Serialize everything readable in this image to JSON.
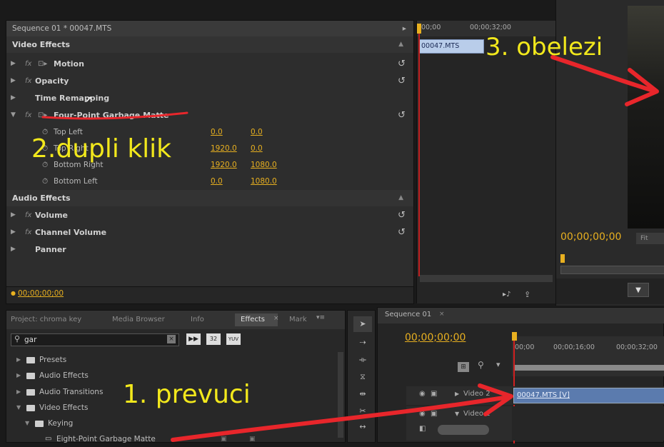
{
  "effect_controls": {
    "title": "Sequence 01 * 00047.MTS",
    "video_effects_label": "Video Effects",
    "effects": [
      {
        "name": "Motion"
      },
      {
        "name": "Opacity"
      },
      {
        "name": "Time Remapping"
      },
      {
        "name": "Four-Point Garbage Matte"
      }
    ],
    "params": [
      {
        "label": "Top Left",
        "x": "0.0",
        "y": "0.0"
      },
      {
        "label": "Top Right",
        "x": "1920.0",
        "y": "0.0"
      },
      {
        "label": "Bottom Right",
        "x": "1920.0",
        "y": "1080.0"
      },
      {
        "label": "Bottom Left",
        "x": "0.0",
        "y": "1080.0"
      }
    ],
    "audio_effects_label": "Audio Effects",
    "audio_effects": [
      {
        "name": "Volume"
      },
      {
        "name": "Channel Volume"
      },
      {
        "name": "Panner"
      }
    ],
    "timecode": "00;00;00;00",
    "mini_timeline": {
      "tick_start": "00;00",
      "tick_mid": "00;00;32;00",
      "clip_label": "00047.MTS"
    }
  },
  "program_monitor": {
    "timecode": "00;00;00;00",
    "fit_label": "Fit"
  },
  "project_panel": {
    "tabs": [
      "Project: chroma key",
      "Media Browser",
      "Info",
      "Effects",
      "Mark"
    ],
    "active_tab": "Effects",
    "search_value": "gar",
    "tree": [
      {
        "label": "Presets"
      },
      {
        "label": "Audio Effects"
      },
      {
        "label": "Audio Transitions"
      },
      {
        "label": "Video Effects"
      },
      {
        "label": "Keying"
      },
      {
        "label": "Eight-Point Garbage Matte"
      }
    ]
  },
  "timeline": {
    "tab": "Sequence 01",
    "timecode": "00;00;00;00",
    "ruler": [
      "00;00",
      "00;00;16;00",
      "00;00;32;00"
    ],
    "tracks": [
      {
        "label": "Video 2"
      },
      {
        "label": "Video 1"
      }
    ],
    "clip_label": "00047.MTS [V]"
  },
  "annotations": {
    "step1": "1. prevuci",
    "step2": "2.dupli klik",
    "step3": "3. obelezi"
  },
  "colors": {
    "accent_gold": "#e8b020",
    "annotation_yellow": "#f2e81c",
    "annotation_red": "#e8262b",
    "playhead_red": "#d02020"
  }
}
